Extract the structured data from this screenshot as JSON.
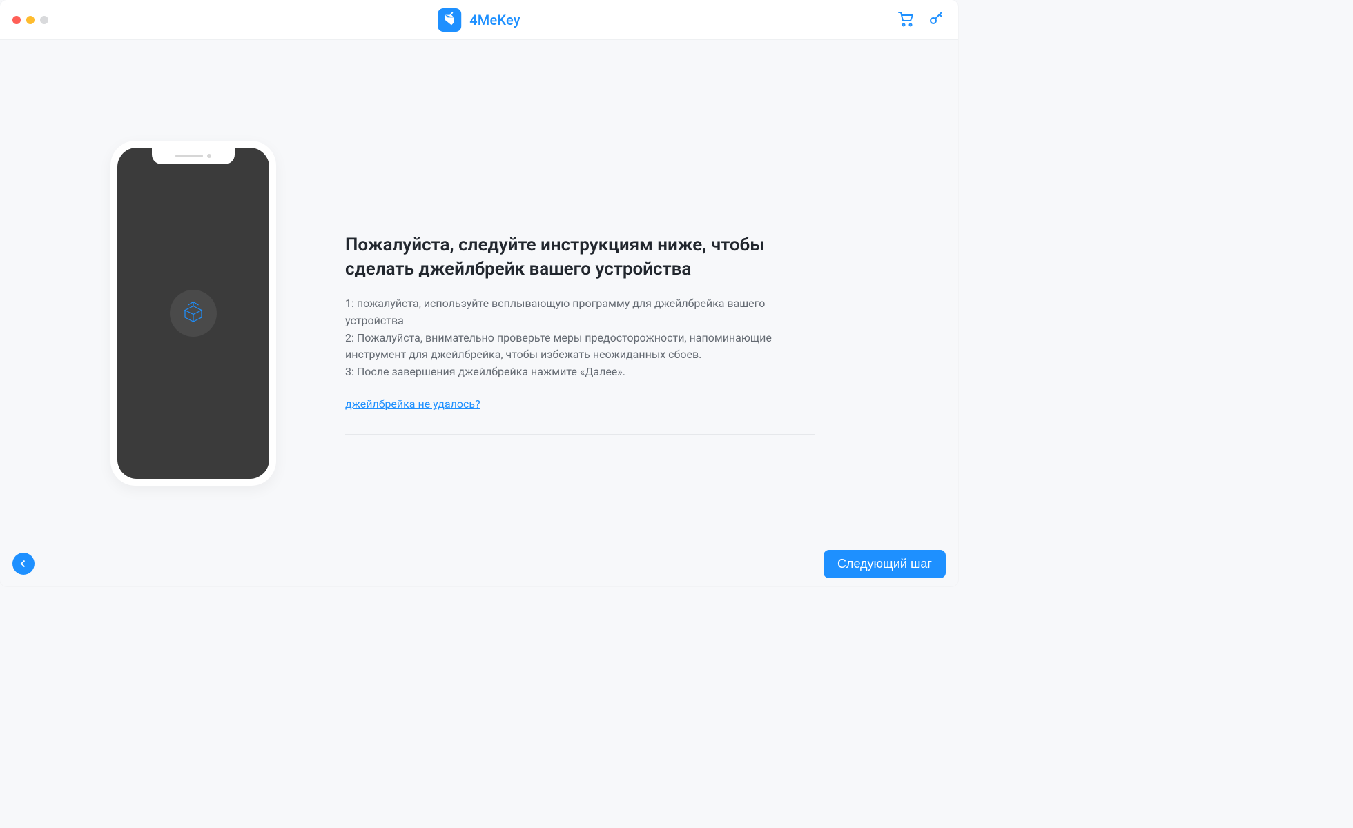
{
  "header": {
    "app_name": "4MeKey"
  },
  "main": {
    "heading": "Пожалуйста, следуйте инструкциям ниже, чтобы сделать джейлбрейк вашего устройства",
    "steps": [
      "1: пожалуйста, используйте всплывающую программу для джейлбрейка вашего устройства",
      "2: Пожалуйста, внимательно проверьте меры предосторожности, напоминающие инструмент для джейлбрейка, чтобы избежать неожиданных сбоев.",
      "3: После завершения джейлбрейка нажмите «Далее»."
    ],
    "help_link": "джейлбрейка не удалось?"
  },
  "footer": {
    "next_label": "Следующий шаг"
  },
  "colors": {
    "accent": "#1e90ff",
    "heading": "#22272e",
    "body": "#656b73",
    "phone_screen": "#3b3b3b"
  }
}
